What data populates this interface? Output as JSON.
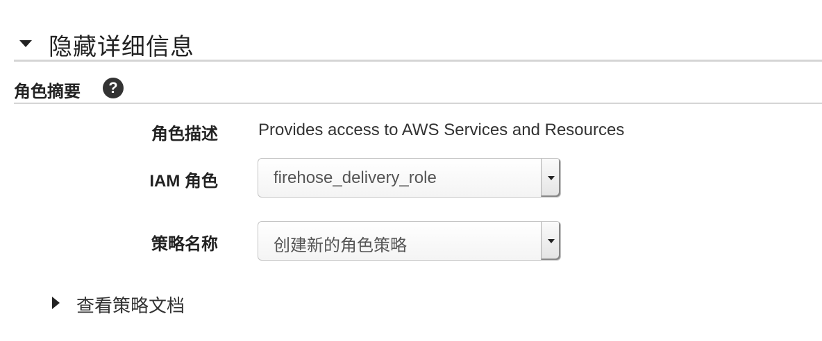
{
  "section": {
    "title": "隐藏详细信息"
  },
  "role_summary": {
    "title": "角色摘要",
    "help_glyph": "?"
  },
  "fields": {
    "description": {
      "label": "角色描述",
      "value": "Provides access to AWS Services and Resources"
    },
    "iam_role": {
      "label": "IAM 角色",
      "selected": "firehose_delivery_role"
    },
    "policy_name": {
      "label": "策略名称",
      "selected": "创建新的角色策略"
    }
  },
  "policy_doc": {
    "label": "查看策略文档"
  }
}
